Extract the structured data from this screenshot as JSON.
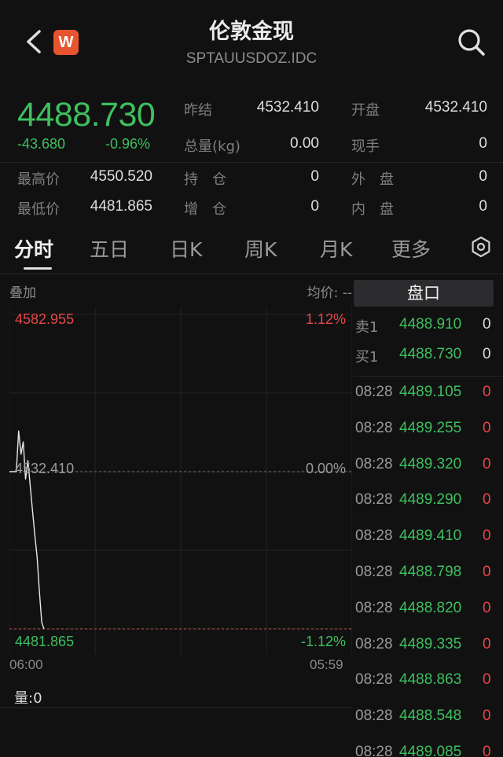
{
  "header": {
    "title": "伦敦金现",
    "symbol": "SPTAUUSDOZ.IDC",
    "logo_letter": "W"
  },
  "quote": {
    "price": "4488.730",
    "change": "-43.680",
    "change_pct": "-0.96%",
    "fields": [
      {
        "label": "昨结",
        "value": "4532.410"
      },
      {
        "label": "开盘",
        "value": "4532.410"
      },
      {
        "label": "总量(kg)",
        "value": "0.00"
      },
      {
        "label": "现手",
        "value": "0"
      },
      {
        "label": "最高价",
        "value": "4550.520"
      },
      {
        "label": "持　仓",
        "value": "0"
      },
      {
        "label": "外　盘",
        "value": "0"
      },
      {
        "label": "最低价",
        "value": "4481.865"
      },
      {
        "label": "增　仓",
        "value": "0"
      },
      {
        "label": "内　盘",
        "value": "0"
      }
    ]
  },
  "tabs": [
    "分时",
    "五日",
    "日K",
    "周K",
    "月K",
    "更多"
  ],
  "chart_header": {
    "overlay": "叠加",
    "avg_price": "均价: --"
  },
  "chart_data": {
    "type": "line",
    "y_top": "4582.955",
    "y_mid": "4532.410",
    "y_bottom": "4481.865",
    "pct_top": "1.12%",
    "pct_mid": "0.00%",
    "pct_bottom": "-1.12%",
    "ylim": [
      4481.865,
      4582.955
    ],
    "x_start": "06:00",
    "x_end": "05:59",
    "volume": "量:0",
    "price_series": [
      4532.41,
      4532.41,
      4532.41,
      4532.41,
      4545.5,
      4538.0,
      4542.0,
      4530.0,
      4536.0,
      4528.0,
      4520.0,
      4512.0,
      4505.0,
      4494.0,
      4484.0,
      4481.865
    ],
    "colors": {
      "up": "#e84747",
      "down": "#3fbf5e",
      "line": "#e8e8e8",
      "grid": "#232325"
    }
  },
  "order_book": {
    "title": "盘口",
    "sell": {
      "label": "卖1",
      "price": "4488.910",
      "qty": "0"
    },
    "buy": {
      "label": "买1",
      "price": "4488.730",
      "qty": "0"
    },
    "trades": [
      {
        "time": "08:28",
        "price": "4489.105",
        "qty": "0"
      },
      {
        "time": "08:28",
        "price": "4489.255",
        "qty": "0"
      },
      {
        "time": "08:28",
        "price": "4489.320",
        "qty": "0"
      },
      {
        "time": "08:28",
        "price": "4489.290",
        "qty": "0"
      },
      {
        "time": "08:28",
        "price": "4489.410",
        "qty": "0"
      },
      {
        "time": "08:28",
        "price": "4488.798",
        "qty": "0"
      },
      {
        "time": "08:28",
        "price": "4488.820",
        "qty": "0"
      },
      {
        "time": "08:28",
        "price": "4489.335",
        "qty": "0"
      },
      {
        "time": "08:28",
        "price": "4488.863",
        "qty": "0"
      },
      {
        "time": "08:28",
        "price": "4488.548",
        "qty": "0"
      },
      {
        "time": "08:28",
        "price": "4489.085",
        "qty": "0"
      }
    ]
  }
}
